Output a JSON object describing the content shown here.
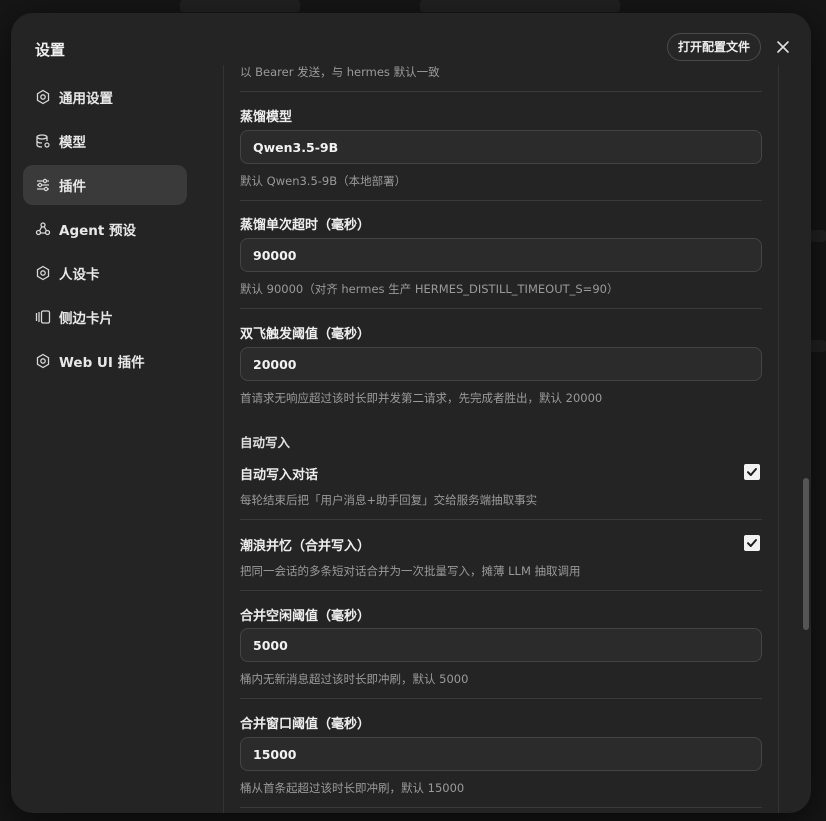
{
  "modal": {
    "title": "设置",
    "open_config_label": "打开配置文件",
    "close_icon": "close-icon"
  },
  "sidebar": {
    "items": [
      {
        "label": "通用设置",
        "icon": "gear-icon",
        "active": false
      },
      {
        "label": "模型",
        "icon": "database-icon",
        "active": false
      },
      {
        "label": "插件",
        "icon": "sliders-icon",
        "active": true
      },
      {
        "label": "Agent 预设",
        "icon": "agent-icon",
        "active": false
      },
      {
        "label": "人设卡",
        "icon": "gear-icon",
        "active": false
      },
      {
        "label": "侧边卡片",
        "icon": "sidebar-cards-icon",
        "active": false
      },
      {
        "label": "Web UI 插件",
        "icon": "gear-icon",
        "active": false
      }
    ]
  },
  "content": {
    "top_hint": "以 Bearer 发送，与 hermes 默认一致",
    "distill_model": {
      "label": "蒸馏模型",
      "value": "Qwen3.5-9B",
      "hint": "默认 Qwen3.5-9B（本地部署）"
    },
    "distill_timeout": {
      "label": "蒸馏单次超时（毫秒）",
      "value": "90000",
      "hint": "默认 90000（对齐 hermes 生产 HERMES_DISTILL_TIMEOUT_S=90）"
    },
    "dual_fire": {
      "label": "双飞触发阈值（毫秒）",
      "value": "20000",
      "hint": "首请求无响应超过该时长即并发第二请求，先完成者胜出，默认 20000"
    },
    "auto_write_section": "自动写入",
    "auto_write_dialog": {
      "label": "自动写入对话",
      "checked": true,
      "hint": "每轮结束后把「用户消息+助手回复」交给服务端抽取事实"
    },
    "merge_write": {
      "label": "潮浪并忆（合并写入）",
      "checked": true,
      "hint": "把同一会话的多条短对话合并为一次批量写入，摊薄 LLM 抽取调用"
    },
    "merge_idle": {
      "label": "合并空闲阈值（毫秒）",
      "value": "5000",
      "hint": "桶内无新消息超过该时长即冲刷，默认 5000"
    },
    "merge_window": {
      "label": "合并窗口阈值（毫秒）",
      "value": "15000",
      "hint": "桶从首条起超过该时长即冲刷，默认 15000"
    }
  }
}
